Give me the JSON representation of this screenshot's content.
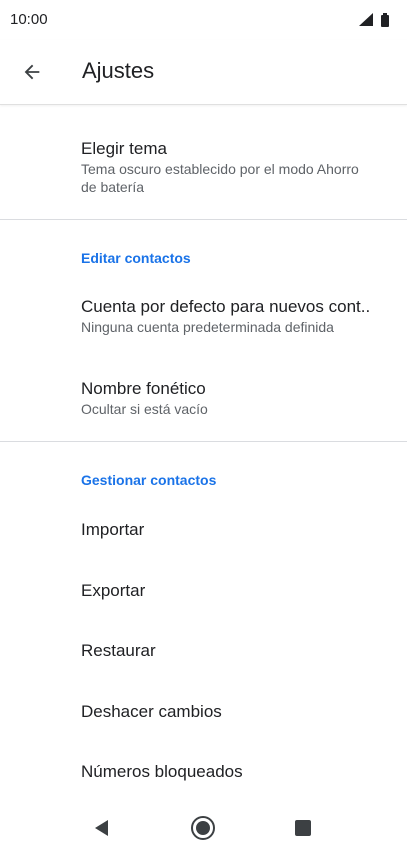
{
  "status_bar": {
    "time": "10:00",
    "icons": [
      "signal-icon",
      "battery-icon"
    ]
  },
  "app_bar": {
    "back_icon": "arrow-back-icon",
    "title": "Ajustes"
  },
  "preferences": {
    "theme": {
      "title": "Elegir tema",
      "summary": "Tema oscuro establecido por el modo Ahorro de batería"
    },
    "edit_section": "Editar contactos",
    "default_account": {
      "title": "Cuenta por defecto para nuevos cont..",
      "summary": "Ninguna cuenta predeterminada definida"
    },
    "phonetic_name": {
      "title": "Nombre fonético",
      "summary": "Ocultar si está vacío"
    },
    "manage_section": "Gestionar contactos",
    "import": "Importar",
    "export": "Exportar",
    "restore": "Restaurar",
    "undo_changes": "Deshacer cambios",
    "blocked_numbers": "Números bloqueados"
  },
  "nav_bar": {
    "icons": [
      "back-triangle-icon",
      "home-circle-icon",
      "recents-square-icon"
    ]
  },
  "colors": {
    "accent": "#1a73e8",
    "text_primary": "#202124",
    "text_secondary": "#5f6368",
    "divider": "#dadce0"
  }
}
